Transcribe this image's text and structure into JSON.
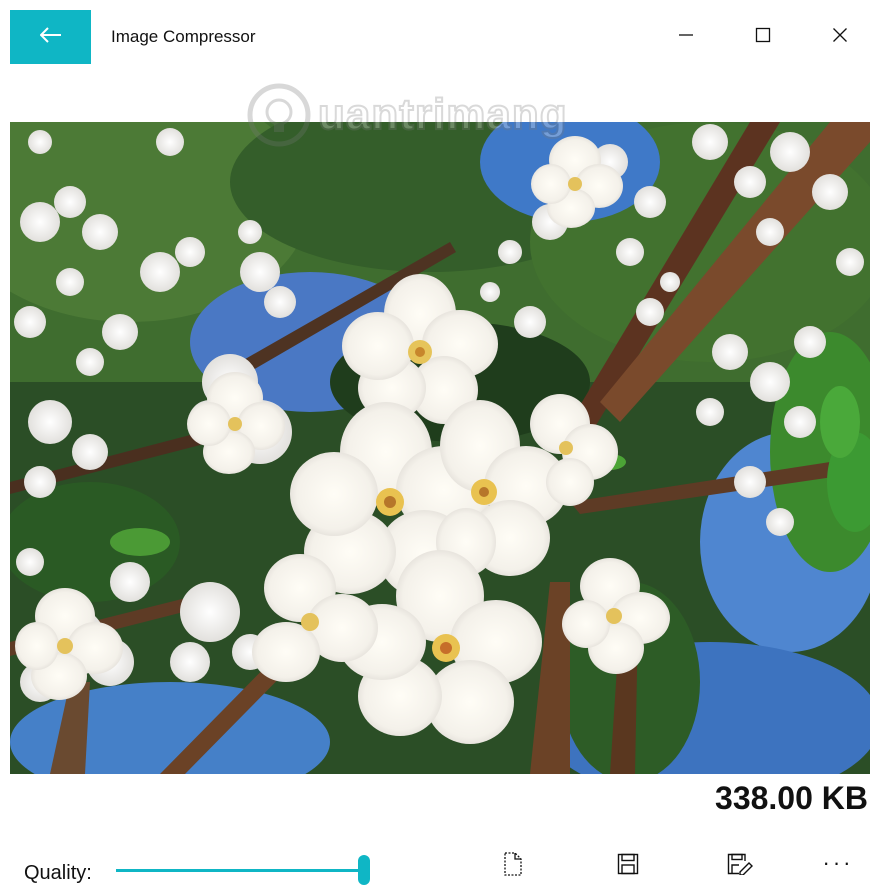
{
  "window": {
    "title": "Image Compressor",
    "accent_color": "#0fb6c5",
    "back_icon": "arrow-left-icon",
    "controls": [
      "minimize-icon",
      "maximize-icon",
      "close-icon"
    ]
  },
  "image": {
    "description_icon": "photo-cherry-blossoms",
    "watermark_text": "uantrimang"
  },
  "status": {
    "file_size": "338.00 KB"
  },
  "toolbar": {
    "quality_label": "Quality:",
    "quality_value": 1.0,
    "buttons": [
      "new-file-icon",
      "save-icon",
      "save-as-icon",
      "more-icon"
    ],
    "more_label": "···"
  }
}
